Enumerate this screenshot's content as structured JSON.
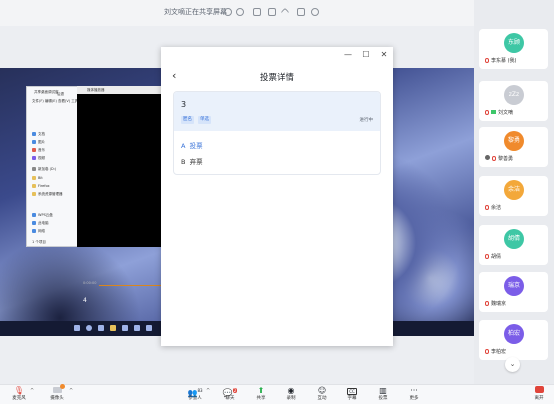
{
  "topbar": {
    "share_status": "刘文嘀正在共享屏幕"
  },
  "explorer": {
    "title": "共享桌面调试窗",
    "toolbar": [
      "文件(F)",
      "编辑(E)",
      "查看(V)",
      "工具(T)"
    ],
    "back_label": "后退",
    "sidebar_items": [
      "文档",
      "图片",
      "音乐",
      "视频",
      "新加卷 (D:)",
      "Bit",
      "Firefox",
      "系统资源管理器",
      "WPS云盘",
      "此电脑",
      "网络"
    ],
    "status": "1 个项目"
  },
  "player": {
    "title": "媒体播放器",
    "time": "0:00:00",
    "counter": "4"
  },
  "modal": {
    "title": "投票详情",
    "back_icon": "chevron-left-icon",
    "question": "3",
    "tags": [
      "匿名",
      "单选"
    ],
    "status": "进行中",
    "options": [
      {
        "key": "A",
        "label": "投票"
      },
      {
        "key": "B",
        "label": "弃票"
      }
    ],
    "option_color": "#3b74d9"
  },
  "participants": [
    {
      "avatar": "东顾",
      "name": "李东慕 (我)",
      "color": "#3ec7a5"
    },
    {
      "avatar": "zZz",
      "name": "刘文嘀",
      "color": "#c9ccd3"
    },
    {
      "avatar": "黎勇",
      "name": "黎善勇",
      "color": "#f08a2c"
    },
    {
      "avatar": "余洁",
      "name": "余洁",
      "color": "#f3a83a"
    },
    {
      "avatar": "胡倩",
      "name": "胡倩",
      "color": "#3ec7a5"
    },
    {
      "avatar": "瑞京",
      "name": "魏瑞京",
      "color": "#7b5de8"
    },
    {
      "avatar": "柏宏",
      "name": "李柏宏",
      "color": "#7b5de8"
    }
  ],
  "bottombar": {
    "mute": "麦克风",
    "video": "摄像头",
    "participants": "参会人",
    "participant_count": "83",
    "chat": "聊天",
    "chat_badge": "2",
    "share": "共享",
    "record": "录制",
    "reaction": "互动",
    "subtitle": "字幕",
    "vote": "投票",
    "more": "更多",
    "leave": "离开"
  }
}
